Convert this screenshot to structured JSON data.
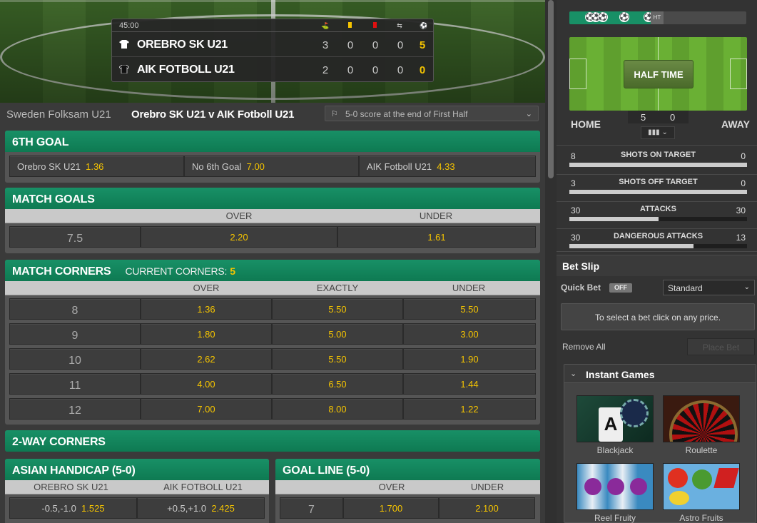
{
  "scoreboard": {
    "clock": "45:00",
    "teams": [
      {
        "name": "OREBRO SK U21",
        "stats": [
          "3",
          "0",
          "0",
          "0"
        ],
        "goals": "5"
      },
      {
        "name": "AIK FOTBOLL U21",
        "stats": [
          "2",
          "0",
          "0",
          "0"
        ],
        "goals": "0"
      }
    ],
    "stat_icons": [
      "corner-flag-icon",
      "yellow-card-icon",
      "red-card-icon",
      "substitution-icon",
      "goal-ball-icon"
    ]
  },
  "breadcrumb": {
    "competition": "Sweden Folksam U21",
    "match": "Orebro SK U21 v AIK Fotboll U21",
    "event_select": "5-0 score at the end of First Half"
  },
  "sixth_goal": {
    "title": "6TH GOAL",
    "options": [
      {
        "label": "Orebro SK U21",
        "odds": "1.36"
      },
      {
        "label": "No 6th Goal",
        "odds": "7.00"
      },
      {
        "label": "AIK Fotboll U21",
        "odds": "4.33"
      }
    ]
  },
  "match_goals": {
    "title": "MATCH GOALS",
    "cols": [
      "OVER",
      "UNDER"
    ],
    "rows": [
      {
        "line": "7.5",
        "over": "2.20",
        "under": "1.61"
      }
    ]
  },
  "match_corners": {
    "title": "MATCH CORNERS",
    "current_label": "CURRENT CORNERS:",
    "current_value": "5",
    "cols": [
      "OVER",
      "EXACTLY",
      "UNDER"
    ],
    "rows": [
      {
        "line": "8",
        "over": "1.36",
        "exactly": "5.50",
        "under": "5.50"
      },
      {
        "line": "9",
        "over": "1.80",
        "exactly": "5.00",
        "under": "3.00"
      },
      {
        "line": "10",
        "over": "2.62",
        "exactly": "5.50",
        "under": "1.90"
      },
      {
        "line": "11",
        "over": "4.00",
        "exactly": "6.50",
        "under": "1.44"
      },
      {
        "line": "12",
        "over": "7.00",
        "exactly": "8.00",
        "under": "1.22"
      }
    ]
  },
  "two_way_corners": {
    "title": "2-WAY CORNERS"
  },
  "asian_handicap": {
    "title": "ASIAN HANDICAP (5-0)",
    "cols": [
      "OREBRO SK U21",
      "AIK FOTBOLL U21"
    ],
    "rows": [
      {
        "home_line": "-0.5,-1.0",
        "home_odds": "1.525",
        "away_line": "+0.5,+1.0",
        "away_odds": "2.425"
      }
    ]
  },
  "goal_line": {
    "title": "GOAL LINE (5-0)",
    "cols": [
      "OVER",
      "UNDER"
    ],
    "rows": [
      {
        "line": "7",
        "over": "1.700",
        "under": "2.100"
      }
    ]
  },
  "live": {
    "ht_marker": "HT",
    "status": "HALF TIME",
    "home_label": "HOME",
    "away_label": "AWAY",
    "home_score": "5",
    "away_score": "0",
    "progress": 0.47,
    "stats": [
      {
        "label": "SHOTS ON TARGET",
        "home": "8",
        "away": "0",
        "home_share": 1.0
      },
      {
        "label": "SHOTS OFF TARGET",
        "home": "3",
        "away": "0",
        "home_share": 1.0
      },
      {
        "label": "ATTACKS",
        "home": "30",
        "away": "30",
        "home_share": 0.5
      },
      {
        "label": "DANGEROUS ATTACKS",
        "home": "30",
        "away": "13",
        "home_share": 0.7
      }
    ]
  },
  "bet_slip": {
    "title": "Bet Slip",
    "quick_bet_label": "Quick Bet",
    "quick_bet_state": "OFF",
    "mode": "Standard",
    "info": "To select a bet click on any price.",
    "remove_all": "Remove All",
    "place_bet": "Place Bet"
  },
  "instant_games": {
    "title": "Instant Games",
    "games": [
      "Blackjack",
      "Roulette",
      "Reel Fruity",
      "Astro Fruits"
    ]
  },
  "colors": {
    "accent": "#138a5e",
    "odds": "#f5c400"
  }
}
